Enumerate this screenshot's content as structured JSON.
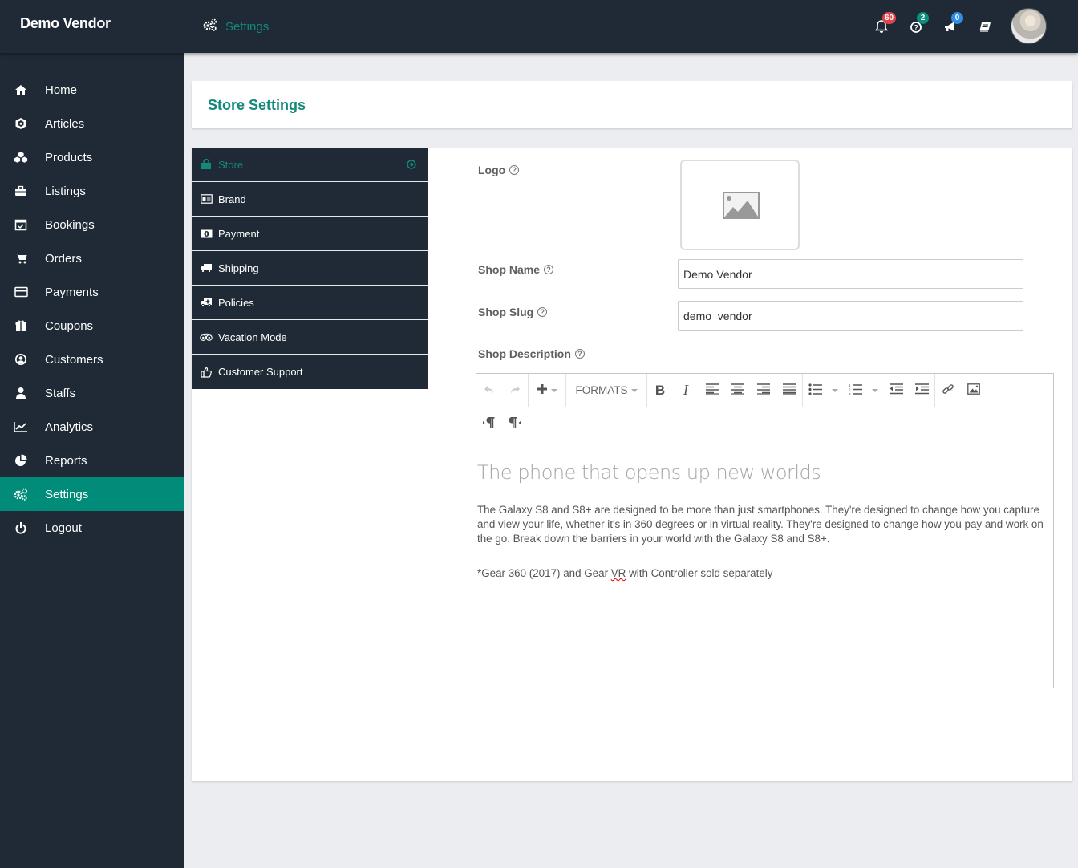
{
  "header": {
    "brand": "Demo Vendor",
    "breadcrumb": {
      "icon": "gears-icon",
      "label": "Settings"
    },
    "notifications": [
      {
        "icon": "bell-icon",
        "count": "60",
        "color": "#e0434b"
      },
      {
        "icon": "question-circle-icon",
        "count": "2",
        "color": "#0c8f7c"
      },
      {
        "icon": "megaphone-icon",
        "count": "0",
        "color": "#2f8ee8"
      },
      {
        "icon": "book-icon",
        "count": null,
        "color": null
      }
    ],
    "avatar": "user-avatar"
  },
  "sidebar": {
    "items": [
      {
        "label": "Home",
        "icon": "home-icon"
      },
      {
        "label": "Articles",
        "icon": "cube-icon"
      },
      {
        "label": "Products",
        "icon": "cubes-icon"
      },
      {
        "label": "Listings",
        "icon": "briefcase-icon"
      },
      {
        "label": "Bookings",
        "icon": "calendar-check-icon"
      },
      {
        "label": "Orders",
        "icon": "cart-icon"
      },
      {
        "label": "Payments",
        "icon": "credit-card-icon"
      },
      {
        "label": "Coupons",
        "icon": "gift-icon"
      },
      {
        "label": "Customers",
        "icon": "user-circle-icon"
      },
      {
        "label": "Staffs",
        "icon": "user-icon"
      },
      {
        "label": "Analytics",
        "icon": "line-chart-icon"
      },
      {
        "label": "Reports",
        "icon": "pie-chart-icon"
      },
      {
        "label": "Settings",
        "icon": "gears-icon",
        "active": true
      },
      {
        "label": "Logout",
        "icon": "power-icon"
      }
    ],
    "active_color": "#008c79"
  },
  "page": {
    "title": "Store Settings",
    "tabs": [
      {
        "label": "Store",
        "icon": "shopping-bag-icon",
        "active": true
      },
      {
        "label": "Brand",
        "icon": "id-card-icon"
      },
      {
        "label": "Payment",
        "icon": "money-icon"
      },
      {
        "label": "Shipping",
        "icon": "truck-icon"
      },
      {
        "label": "Policies",
        "icon": "ambulance-icon"
      },
      {
        "label": "Vacation Mode",
        "icon": "tripadvisor-icon"
      },
      {
        "label": "Customer Support",
        "icon": "thumbs-up-icon"
      }
    ],
    "form": {
      "logo_label": "Logo",
      "shop_name_label": "Shop Name",
      "shop_name_value": "Demo Vendor",
      "shop_slug_label": "Shop Slug",
      "shop_slug_value": "demo_vendor",
      "shop_description_label": "Shop Description",
      "editor": {
        "toolbar": {
          "formats_label": "FORMATS"
        },
        "heading": "The phone that opens up new worlds",
        "paragraph": "The Galaxy S8 and S8+ are designed to be more than just smartphones. They're designed to change how you capture and view your life, whether it's in 360 degrees or in virtual reality. They're designed to change how you pay and work on the go. Break down the barriers in your world with the Galaxy S8 and S8+.",
        "note_before": "*Gear 360 (2017) and Gear ",
        "note_spell": "VR",
        "note_after": " with Controller sold separately"
      }
    }
  }
}
